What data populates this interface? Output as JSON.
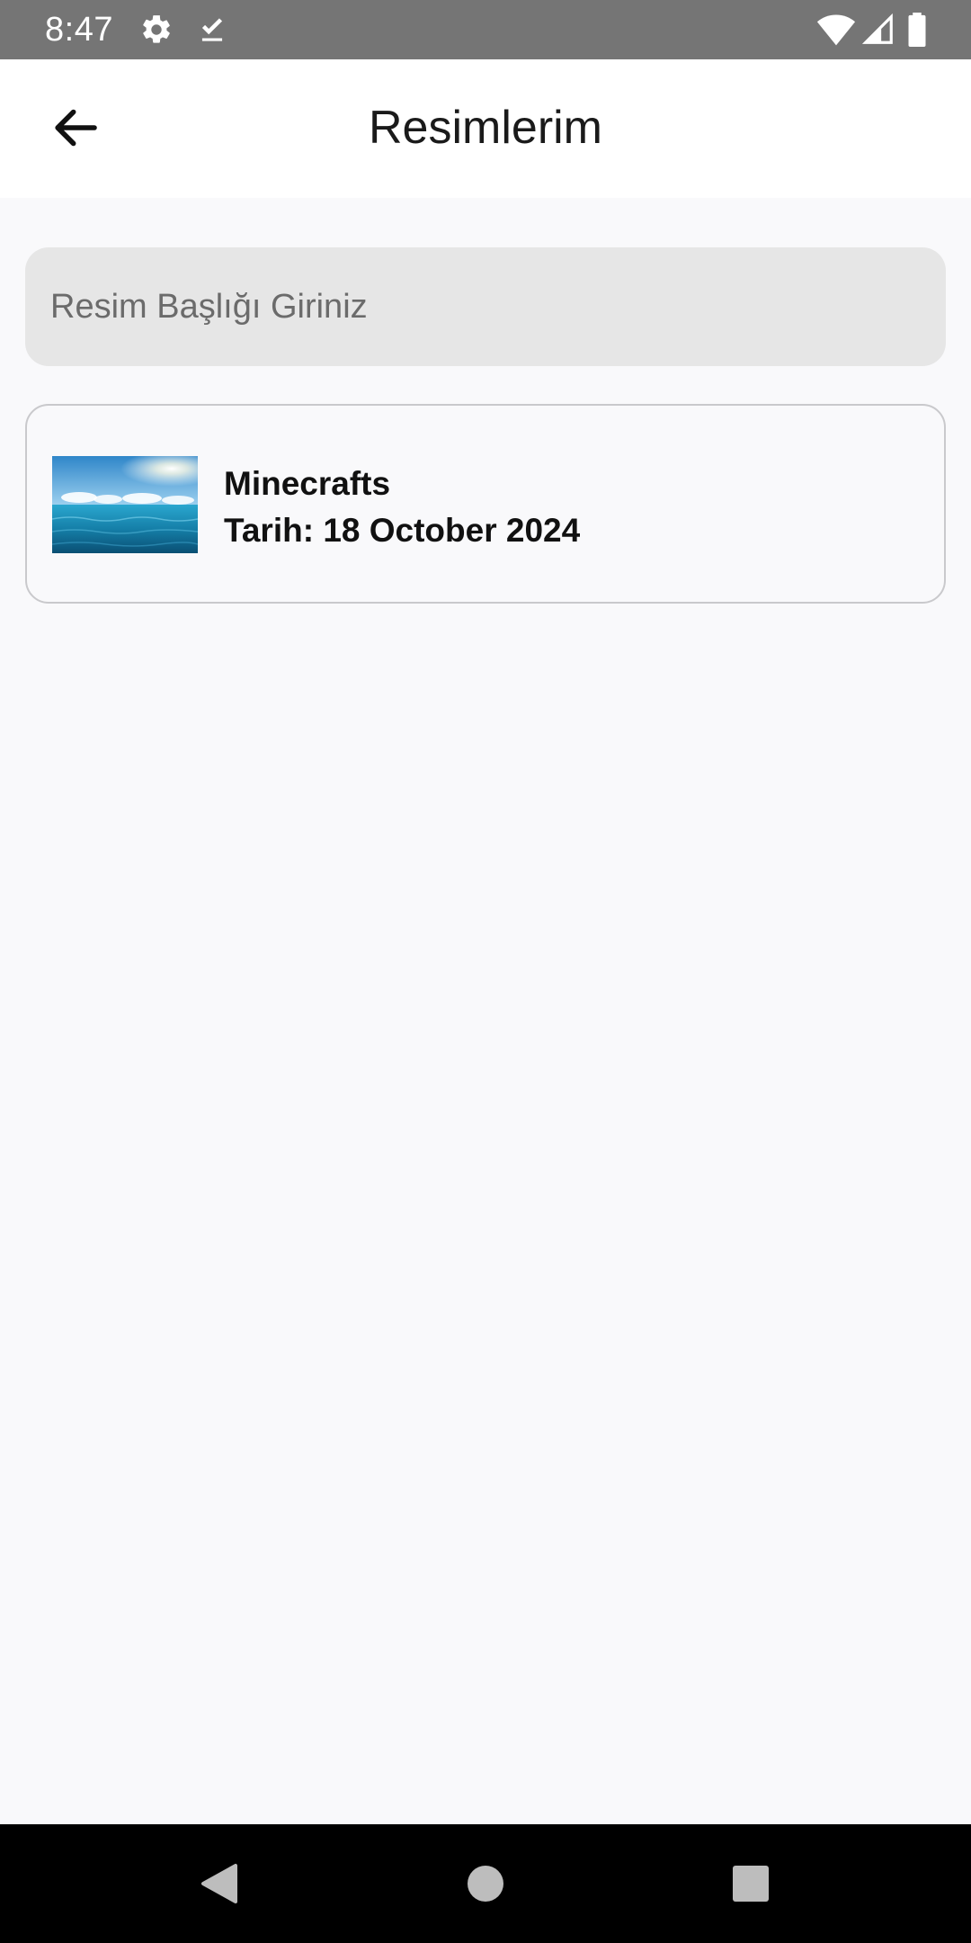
{
  "status_bar": {
    "time": "8:47",
    "icons": [
      "settings-gear-icon",
      "download-done-icon",
      "wifi-icon",
      "cell-signal-icon",
      "battery-icon"
    ]
  },
  "app_bar": {
    "title": "Resimlerim",
    "back_icon": "arrow-back-icon"
  },
  "search": {
    "placeholder": "Resim Başlığı Giriniz",
    "value": ""
  },
  "images": [
    {
      "title": "Minecrafts",
      "date_text": "Tarih: 18 October 2024",
      "thumbnail": "sea-sky-thumbnail"
    }
  ],
  "nav_bar": {
    "icons": [
      "back-triangle-icon",
      "home-circle-icon",
      "recents-square-icon"
    ]
  },
  "colors": {
    "status_bar": "#757575",
    "app_bar": "#ffffff",
    "background": "#f9f9fb",
    "input_bg": "#e6e6e6",
    "card_border": "#c9c9cc",
    "nav_bar": "#000000"
  }
}
